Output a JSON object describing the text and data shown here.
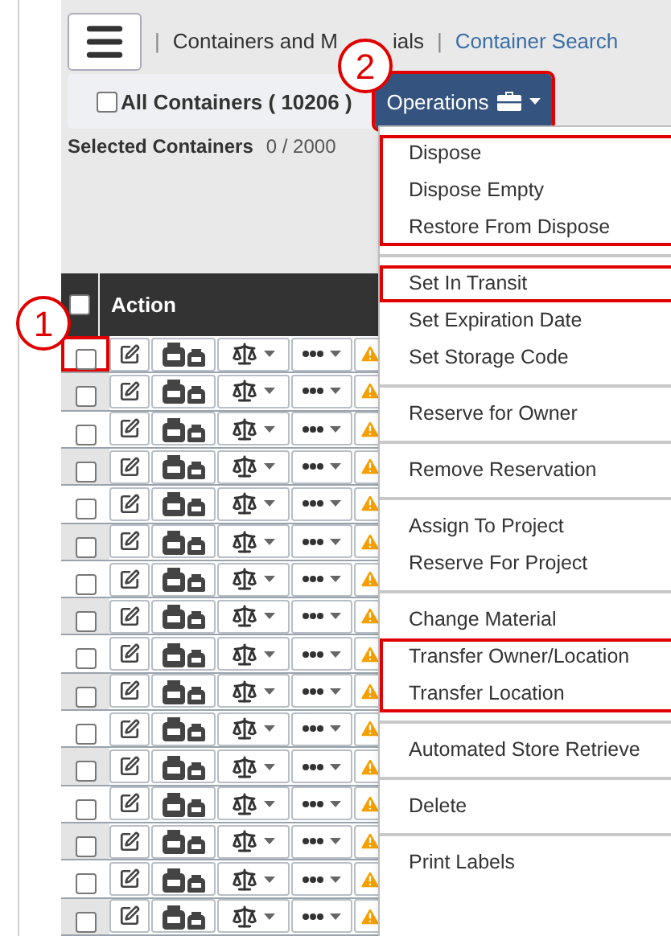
{
  "header": {
    "breadcrumb_before": "|",
    "breadcrumb_start": "Containers and M",
    "breadcrumb_end": "ials",
    "separator": "|",
    "link": "Container Search"
  },
  "toolbar": {
    "all_containers": {
      "label": "All Containers",
      "count": "( 10206 )",
      "checked": false
    },
    "operations": {
      "label": "Operations",
      "highlighted": true
    }
  },
  "selected": {
    "label": "Selected Containers",
    "value": "0 / 2000"
  },
  "table": {
    "header_checked": false,
    "column": "Action",
    "rows": [
      {
        "checked": false,
        "highlighted": true
      },
      {
        "checked": false,
        "highlighted": false
      },
      {
        "checked": false,
        "highlighted": false
      },
      {
        "checked": false,
        "highlighted": false
      },
      {
        "checked": false,
        "highlighted": false
      },
      {
        "checked": false,
        "highlighted": false
      },
      {
        "checked": false,
        "highlighted": false
      },
      {
        "checked": false,
        "highlighted": false
      },
      {
        "checked": false,
        "highlighted": false
      },
      {
        "checked": false,
        "highlighted": false
      },
      {
        "checked": false,
        "highlighted": false
      },
      {
        "checked": false,
        "highlighted": false
      },
      {
        "checked": false,
        "highlighted": false
      },
      {
        "checked": false,
        "highlighted": false
      },
      {
        "checked": false,
        "highlighted": false
      },
      {
        "checked": false,
        "highlighted": false
      }
    ]
  },
  "menu": [
    {
      "groups": [
        {
          "highlighted": true,
          "items": [
            "Dispose",
            "Dispose Empty",
            "Restore From Dispose"
          ]
        }
      ]
    },
    {
      "groups": [
        {
          "highlighted": true,
          "items": [
            "Set In Transit"
          ]
        },
        {
          "highlighted": false,
          "items": [
            "Set Expiration Date",
            "Set Storage Code"
          ]
        }
      ]
    },
    {
      "groups": [
        {
          "highlighted": false,
          "items": [
            "Reserve for Owner"
          ]
        }
      ]
    },
    {
      "groups": [
        {
          "highlighted": false,
          "items": [
            "Remove Reservation"
          ]
        }
      ]
    },
    {
      "groups": [
        {
          "highlighted": false,
          "items": [
            "Assign To Project",
            "Reserve For Project"
          ]
        }
      ]
    },
    {
      "groups": [
        {
          "highlighted": false,
          "items": [
            "Change Material"
          ]
        },
        {
          "highlighted": true,
          "items": [
            "Transfer Owner/Location",
            "Transfer Location"
          ]
        }
      ]
    },
    {
      "groups": [
        {
          "highlighted": false,
          "items": [
            "Automated Store Retrieve"
          ]
        }
      ]
    },
    {
      "groups": [
        {
          "highlighted": false,
          "items": [
            "Delete"
          ]
        }
      ]
    },
    {
      "groups": [
        {
          "highlighted": false,
          "items": [
            "Print Labels"
          ]
        }
      ]
    }
  ],
  "callouts": [
    {
      "label": "1"
    },
    {
      "label": "2"
    }
  ]
}
